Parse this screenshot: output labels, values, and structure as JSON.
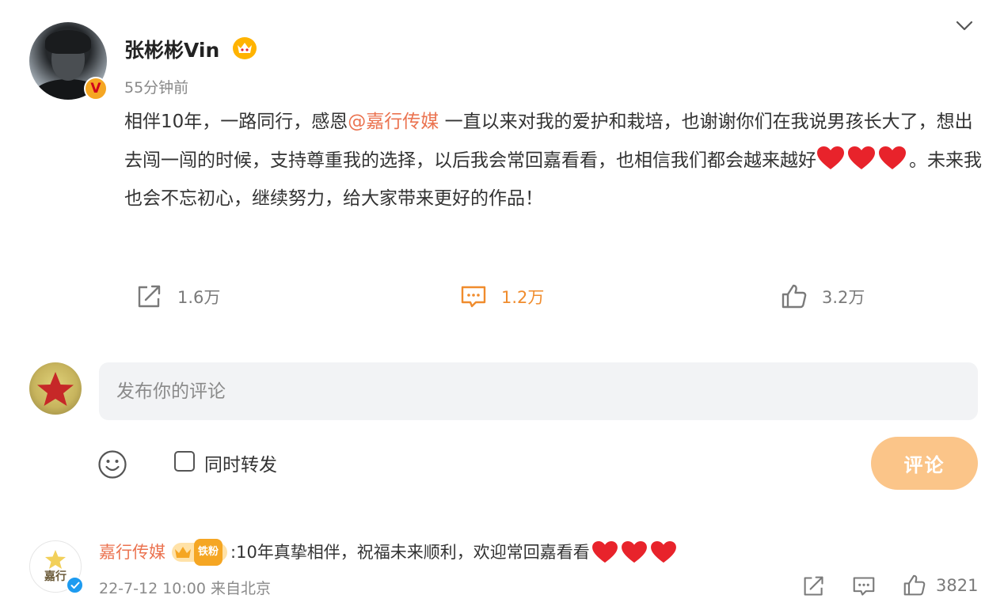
{
  "post": {
    "author": "张彬彬Vin",
    "time": "55分钟前",
    "body": {
      "part1": "相伴10年，一路同行，感恩",
      "mention": "@嘉行传媒",
      "part2": " 一直以来对我的爱护和栽培，也谢谢你们在我说男孩长大了，想出去闯一闯的时候，支持尊重我的选择，以后我会常回嘉看看，也相信我们都会越来越好",
      "part3": "。未来我也会不忘初心，继续努力，给大家带来更好的作品！"
    },
    "actions": {
      "repost_count": "1.6万",
      "comment_count": "1.2万",
      "like_count": "3.2万"
    }
  },
  "composer": {
    "placeholder": "发布你的评论",
    "repost_label": "同时转发",
    "submit_label": "评论"
  },
  "comment": {
    "author": "嘉行传媒",
    "badge_label": "铁粉",
    "text": ":10年真挚相伴，祝福未来顺利，欢迎常回嘉看看",
    "avatar_text": "嘉行",
    "time": "22-7-12 10:00",
    "source": "来自北京",
    "like_count": "3821"
  },
  "icons": {
    "more": "chevron-down-icon",
    "repost": "share-icon",
    "comment": "comment-icon",
    "like": "thumbs-up-icon",
    "emoji": "smiley-icon",
    "heart": "red-heart-emoji"
  },
  "colors": {
    "accent": "#eb7350",
    "active_action": "#f08c2d",
    "submit_button": "#fbc589",
    "input_background": "#f2f3f5",
    "heart": "#e8232b"
  }
}
